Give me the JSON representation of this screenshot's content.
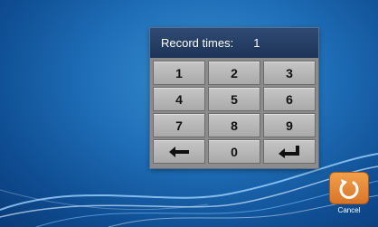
{
  "dialog": {
    "title": "Record times:",
    "value": "1"
  },
  "keypad": {
    "keys": [
      "1",
      "2",
      "3",
      "4",
      "5",
      "6",
      "7",
      "8",
      "9",
      "0"
    ],
    "backspace_icon": "arrow-left-icon",
    "enter_icon": "enter-return-icon"
  },
  "cancel": {
    "label": "Cancel",
    "icon": "undo-icon",
    "color": "#e5862f"
  },
  "colors": {
    "background": "#1f6fb8",
    "header": "#25406a",
    "keypad_panel": "#8c8c8c"
  }
}
